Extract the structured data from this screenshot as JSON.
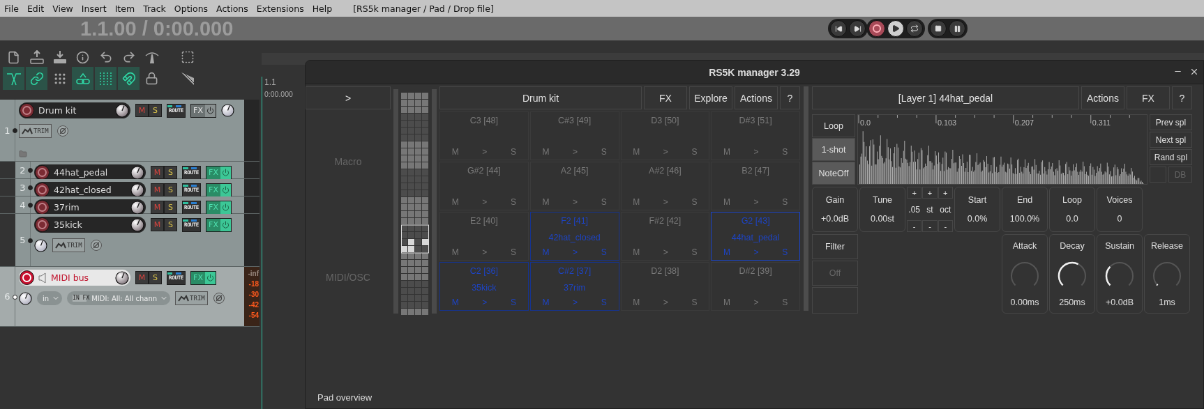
{
  "menu": [
    "File",
    "Edit",
    "View",
    "Insert",
    "Item",
    "Track",
    "Options",
    "Actions",
    "Extensions",
    "Help"
  ],
  "window_title": "[RS5k manager / Pad / Drop file]",
  "transport": {
    "time": "1.1.00 / 0:00.000"
  },
  "toolbar_toggles": [
    {
      "on": true
    },
    {
      "on": true
    },
    {
      "on": false
    },
    {
      "on": true
    },
    {
      "on": true
    },
    {
      "on": true
    },
    {
      "on": false
    }
  ],
  "ruler": {
    "bar": "1.1",
    "time": "0:00.000"
  },
  "tracks": [
    {
      "number": "1",
      "name": "Drum kit",
      "selected": false,
      "armed": false,
      "fx_enabled": false,
      "mute": "M",
      "solo": "S",
      "route": "ROUTE",
      "fx": "FX",
      "trim": "TRIM",
      "children": [
        {
          "number": "2",
          "name": "44hat_pedal",
          "selected": false,
          "armed": false,
          "fx_enabled": true,
          "mute": "M",
          "solo": "S",
          "route": "ROUTE",
          "fx": "FX"
        },
        {
          "number": "3",
          "name": "42hat_closed",
          "selected": false,
          "armed": false,
          "fx_enabled": true,
          "mute": "M",
          "solo": "S",
          "route": "ROUTE",
          "fx": "FX"
        },
        {
          "number": "4",
          "name": "37rim",
          "selected": false,
          "armed": false,
          "fx_enabled": true,
          "mute": "M",
          "solo": "S",
          "route": "ROUTE",
          "fx": "FX"
        },
        {
          "number": "5",
          "name": "35kick",
          "selected": false,
          "armed": false,
          "fx_enabled": true,
          "mute": "M",
          "solo": "S",
          "route": "ROUTE",
          "fx": "FX",
          "trim": "TRIM"
        }
      ]
    },
    {
      "number": "6",
      "name": "MIDI bus",
      "selected": true,
      "armed": true,
      "fx_enabled": true,
      "mute": "M",
      "solo": "S",
      "route": "ROUTE",
      "fx": "FX",
      "trim": "TRIM",
      "input": "in",
      "input_fx": "IN FX",
      "midi_input": "MIDI: All: All chann",
      "meter_labels": [
        "-inf",
        "-18",
        "-30",
        "-42",
        "-54"
      ]
    }
  ],
  "rs5k": {
    "title": "RS5K manager 3.29",
    "expand": ">",
    "sections": [
      "Macro",
      "MIDI/OSC"
    ],
    "pad_overview": "Pad overview",
    "rack_buttons": [
      "Drum kit",
      "FX",
      "Explore",
      "Actions",
      "?"
    ],
    "pads": [
      {
        "note": "C3 [48]",
        "buttons": [
          "M",
          ">",
          "S"
        ],
        "selected": false
      },
      {
        "note": "C#3 [49]",
        "buttons": [
          "M",
          ">",
          "S"
        ],
        "selected": false
      },
      {
        "note": "D3 [50]",
        "buttons": [
          "M",
          ">",
          "S"
        ],
        "selected": false
      },
      {
        "note": "D#3 [51]",
        "buttons": [
          "M",
          ">",
          "S"
        ],
        "selected": false
      },
      {
        "note": "G#2 [44]",
        "buttons": [
          "M",
          ">",
          "S"
        ],
        "selected": false
      },
      {
        "note": "A2 [45]",
        "buttons": [
          "M",
          ">",
          "S"
        ],
        "selected": false
      },
      {
        "note": "A#2 [46]",
        "buttons": [
          "M",
          ">",
          "S"
        ],
        "selected": false
      },
      {
        "note": "B2 [47]",
        "buttons": [
          "M",
          ">",
          "S"
        ],
        "selected": false
      },
      {
        "note": "E2 [40]",
        "buttons": [
          "M",
          ">",
          "S"
        ],
        "selected": false
      },
      {
        "note": "F2 [41]",
        "sample": "42hat_closed",
        "buttons": [
          "M",
          ">",
          "S"
        ],
        "selected": false
      },
      {
        "note": "F#2 [42]",
        "buttons": [
          "M",
          ">",
          "S"
        ],
        "selected": false
      },
      {
        "note": "G2 [43]",
        "sample": "44hat_pedal",
        "buttons": [
          "M",
          ">",
          "S"
        ],
        "selected": true
      },
      {
        "note": "C2 [36]",
        "sample": "35kick",
        "buttons": [
          "M",
          ">",
          "S"
        ],
        "selected": false
      },
      {
        "note": "C#2 [37]",
        "sample": "37rim",
        "buttons": [
          "M",
          ">",
          "S"
        ],
        "selected": false
      },
      {
        "note": "D2 [38]",
        "buttons": [
          "M",
          ">",
          "S"
        ],
        "selected": false
      },
      {
        "note": "D#2 [39]",
        "buttons": [
          "M",
          ">",
          "S"
        ],
        "selected": false
      }
    ],
    "layer_buttons": [
      "[Layer 1] 44hat_pedal",
      "Actions",
      "FX",
      "?"
    ],
    "modes": [
      {
        "label": "Loop",
        "selected": false
      },
      {
        "label": "1-shot",
        "selected": true
      },
      {
        "label": "NoteOff",
        "selected": true
      }
    ],
    "waveform_ticks": [
      "0.0",
      "0.103",
      "0.207",
      "0.311"
    ],
    "sample_buttons": [
      {
        "label": "Prev spl",
        "disabled": false
      },
      {
        "label": "Next spl",
        "disabled": false
      },
      {
        "label": "Rand spl",
        "disabled": false
      },
      {
        "label": "DB",
        "disabled": true
      }
    ],
    "params": [
      {
        "kind": "value",
        "label": "Gain",
        "value": "+0.0dB"
      },
      {
        "kind": "value",
        "label": "Tune",
        "value": "0.00st"
      },
      {
        "kind": "steps",
        "plus": [
          "+",
          "+",
          "+"
        ],
        "units": [
          ".05",
          "st",
          "oct"
        ],
        "minus": [
          "-",
          "-",
          "-"
        ]
      },
      {
        "kind": "value",
        "label": "Start",
        "value": "0.0%"
      },
      {
        "kind": "value",
        "label": "End",
        "value": "100.0%"
      },
      {
        "kind": "value",
        "label": "Loop",
        "value": "0.0"
      },
      {
        "kind": "value",
        "label": "Voices",
        "value": "0"
      }
    ],
    "filter": [
      {
        "label": "Filter",
        "disabled": false
      },
      {
        "label": "Off",
        "disabled": true
      }
    ],
    "envelope": [
      {
        "label": "Attack",
        "value": "0.00ms"
      },
      {
        "label": "Decay",
        "value": "250ms"
      },
      {
        "label": "Sustain",
        "value": "+0.0dB"
      },
      {
        "label": "Release",
        "value": "1ms"
      }
    ]
  }
}
